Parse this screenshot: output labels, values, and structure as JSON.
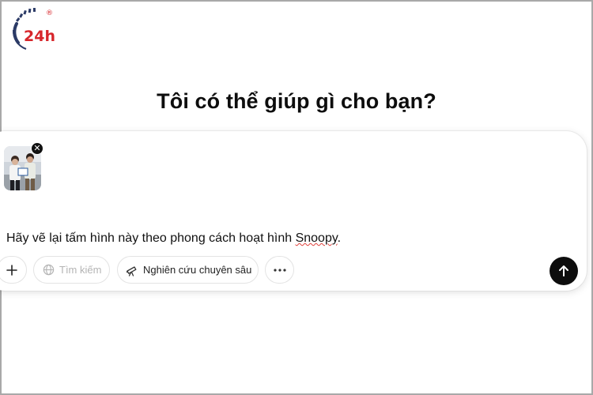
{
  "brand": {
    "logo_text": "24h",
    "registered_mark": "®",
    "accent_color": "#d7262b",
    "dark_color": "#2b3a66"
  },
  "main": {
    "headline": "Tôi có thể giúp gì cho bạn?"
  },
  "composer": {
    "attachment": {
      "icon": "image-thumbnail",
      "remove_icon": "close-icon"
    },
    "prompt_before": "Hãy vẽ lại tấm hình này theo phong cách hoạt hình ",
    "prompt_misspelled": "Snoopy",
    "prompt_after": ".",
    "toolbar": {
      "add_icon": "plus-icon",
      "search_label": "Tìm kiếm",
      "search_icon": "globe-icon",
      "research_label": "Nghiên cứu chuyên sâu",
      "research_icon": "telescope-icon",
      "more_icon": "ellipsis-icon",
      "send_icon": "arrow-up-icon"
    }
  }
}
